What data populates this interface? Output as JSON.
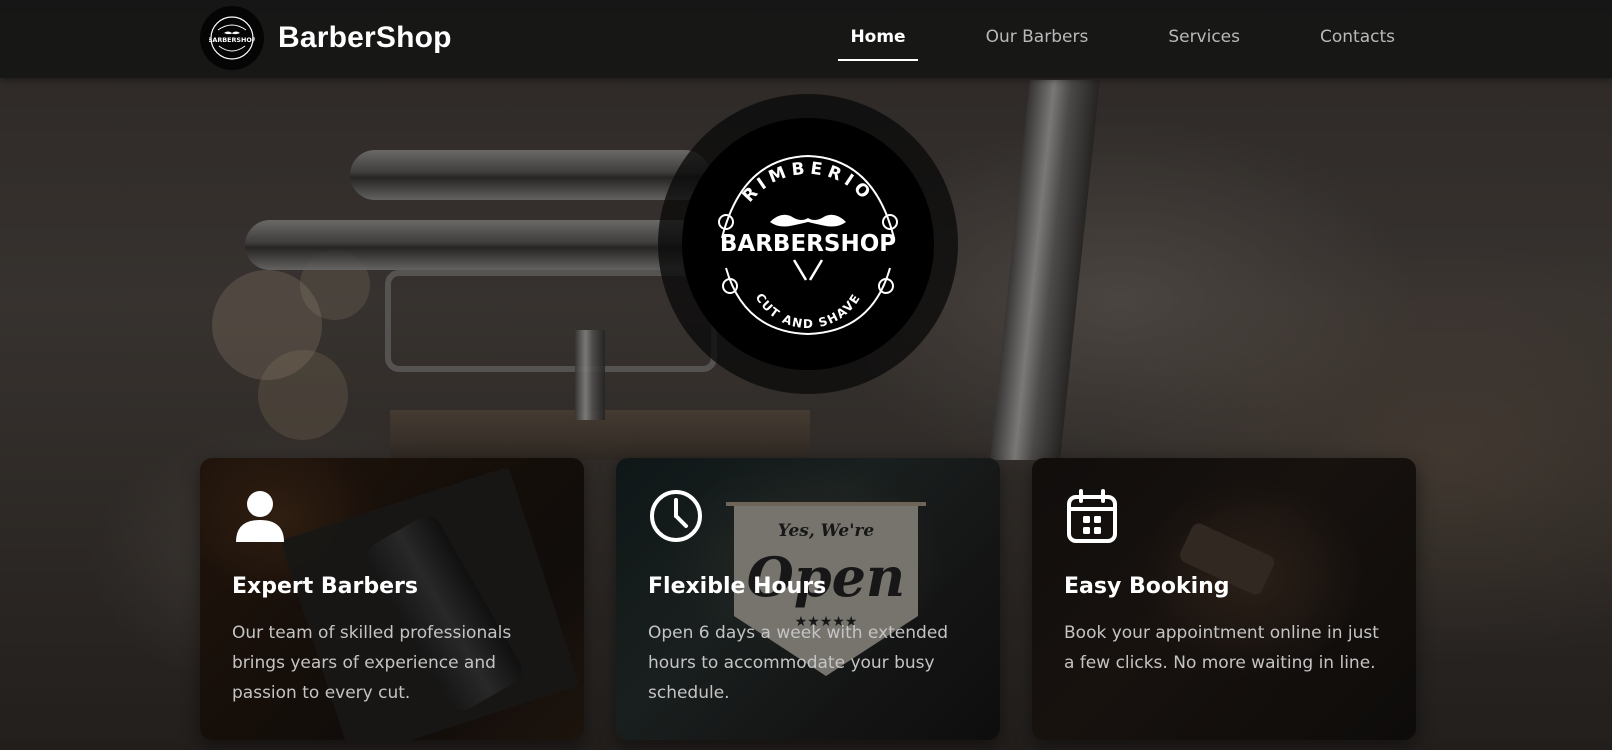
{
  "brand": {
    "name": "BarberShop",
    "logo_text": "BARBERSHOP"
  },
  "nav": {
    "items": [
      {
        "label": "Home",
        "active": true
      },
      {
        "label": "Our Barbers",
        "active": false
      },
      {
        "label": "Services",
        "active": false
      },
      {
        "label": "Contacts",
        "active": false
      }
    ]
  },
  "emblem": {
    "top_text": "RIMBERIO",
    "main_text": "BARBERSHOP",
    "bottom_text": "CUT AND SHAVE"
  },
  "features": [
    {
      "icon": "user-icon",
      "title": "Expert Barbers",
      "text": "Our team of skilled professionals brings years of experience and passion to every cut."
    },
    {
      "icon": "clock-icon",
      "title": "Flexible Hours",
      "text": "Open 6 days a week with extended hours to accommodate your busy schedule."
    },
    {
      "icon": "calendar-icon",
      "title": "Easy Booking",
      "text": "Book your appointment online in just a few clicks. No more waiting in line."
    }
  ],
  "sign": {
    "line1": "Yes, We're",
    "line2": "Open"
  },
  "colors": {
    "navbar_bg": "#161616",
    "nav_active": "#ffffff",
    "nav_inactive": "#b9b9b9",
    "card_text": "#c4c4c4"
  }
}
